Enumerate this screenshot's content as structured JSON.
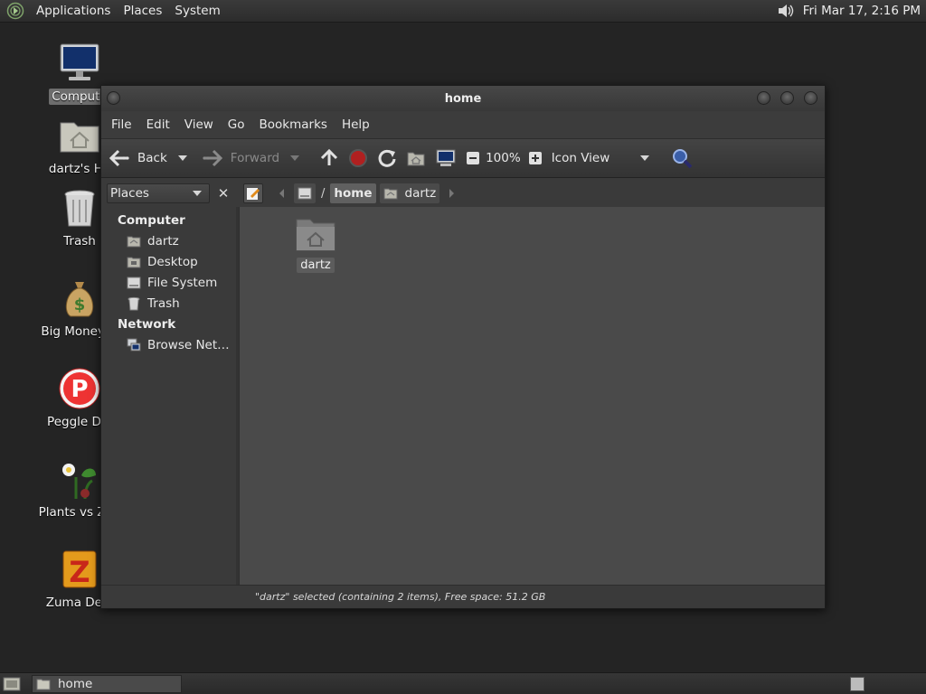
{
  "top_panel": {
    "menus": [
      "Applications",
      "Places",
      "System"
    ],
    "clock": "Fri Mar 17,  2:16 PM"
  },
  "desktop": {
    "icons": [
      {
        "label": "Compute",
        "icon": "computer-icon",
        "selected": true
      },
      {
        "label": "dartz's Ho",
        "icon": "home-folder-icon"
      },
      {
        "label": "Trash",
        "icon": "trash-icon"
      },
      {
        "label": "Big Money D",
        "icon": "money-bag-icon"
      },
      {
        "label": "Peggle Del",
        "icon": "peggle-icon"
      },
      {
        "label": "Plants vs Zon",
        "icon": "plants-icon"
      },
      {
        "label": "Zuma Delu",
        "icon": "zuma-icon"
      }
    ]
  },
  "window": {
    "title": "home",
    "menu": [
      "File",
      "Edit",
      "View",
      "Go",
      "Bookmarks",
      "Help"
    ],
    "toolbar": {
      "back": "Back",
      "forward": "Forward",
      "zoom": "100%",
      "view_mode": "Icon View"
    },
    "location": {
      "places_label": "Places",
      "separator": "/",
      "crumbs": [
        "home",
        "dartz"
      ]
    },
    "sidebar": {
      "computer_header": "Computer",
      "computer_items": [
        {
          "label": "dartz",
          "icon": "home-folder-icon"
        },
        {
          "label": "Desktop",
          "icon": "desktop-folder-icon"
        },
        {
          "label": "File System",
          "icon": "drive-icon"
        },
        {
          "label": "Trash",
          "icon": "trash-icon"
        }
      ],
      "network_header": "Network",
      "network_items": [
        {
          "label": "Browse Net…",
          "icon": "network-icon"
        }
      ]
    },
    "files": [
      {
        "label": "dartz",
        "icon": "home-folder-icon",
        "selected": true
      }
    ],
    "status": "\"dartz\" selected (containing 2 items), Free space: 51.2 GB"
  },
  "bottom_panel": {
    "task": "home"
  }
}
